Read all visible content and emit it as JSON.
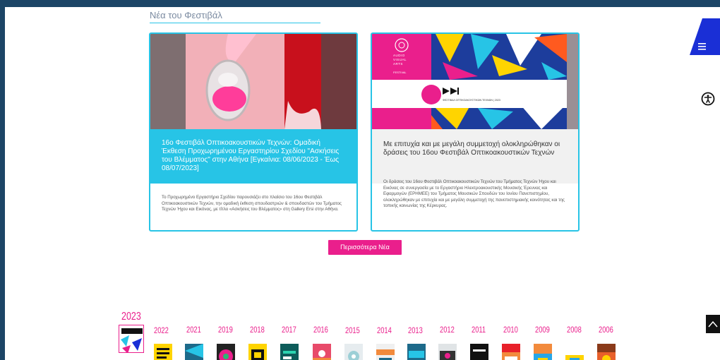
{
  "section": {
    "title": "Νέα του Φεστιβάλ"
  },
  "cards": [
    {
      "title": "16ο Φεστιβάλ Οπτικοακουστικών Τεχνών: Ομαδική Έκθεση Προχωρημένου Εργαστηρίου Σχεδίου \"Ασκήσεις του Βλέμματος\" στην Αθήνα [Εγκαίνια: 08/06/2023 - Έως 08/07/2023]",
      "body": "Το Προχωρημένο Εργαστήριο Σχεδίου παρουσιάζει στο πλαίσιο του 16ου Φεστιβάλ Οπτικοακουστικών Τεχνών, την ομαδική έκθεση σπουδαστριών & σπουδαστών του Τμήματος Τεχνών Ήχου και Εικόνας, με τίτλο «Ασκήσεις του Βλέμματος» στη Gallery Ersi στην Αθήνα."
    },
    {
      "title": "Με επιτυχία και με μεγάλη συμμετοχή ολοκληρώθηκαν οι δράσεις του 16ου Φεστιβάλ Οπτικοακουστικών Τεχνών",
      "body": "Οι δράσεις του 16ου Φεστιβάλ Οπτικοακουστικών Τεχνών του Τμήματος Τεχνών Ήχου και Εικόνας σε συνεργασία με το Εργαστήριο Ηλεκτροακουστικής Μουσικής Έρευνας και Εφαρμογών (ΕΡΗΜΕΕ) του Τμήματος Μουσικών Σπουδών του Ιονίου Πανεπιστημίου, ολοκληρώθηκαν με επιτυχία και με μεγάλη συμμετοχή της πανεπιστημιακής κοινότητας και της τοπικής κοινωνίας της Κέρκυρας.",
      "logo_lines": [
        "AUDIO",
        "VISUAL",
        "ARTS"
      ],
      "logo_small": "FESTIVAL",
      "banner_caption": "ΦΕΣΤΙΒΑΛ ΟΠΤΙΚΟΑΚΟΥΣΤΙΚΩΝ ΤΕΧΝΩΝ | 2023"
    }
  ],
  "more_button": "Περισσότερα Νέα",
  "years": [
    "2023",
    "2022",
    "2021",
    "2019",
    "2018",
    "2017",
    "2016",
    "2015",
    "2014",
    "2013",
    "2012",
    "2011",
    "2010",
    "2009",
    "2008",
    "2006"
  ],
  "colors": {
    "accent": "#27c4e6",
    "brand": "#ea1f8c",
    "frame": "#1c4566",
    "menu": "#1a2fd6"
  },
  "icons": {
    "menu": "hamburger-icon",
    "accessibility": "accessibility-icon",
    "top": "chevron-up-icon"
  }
}
